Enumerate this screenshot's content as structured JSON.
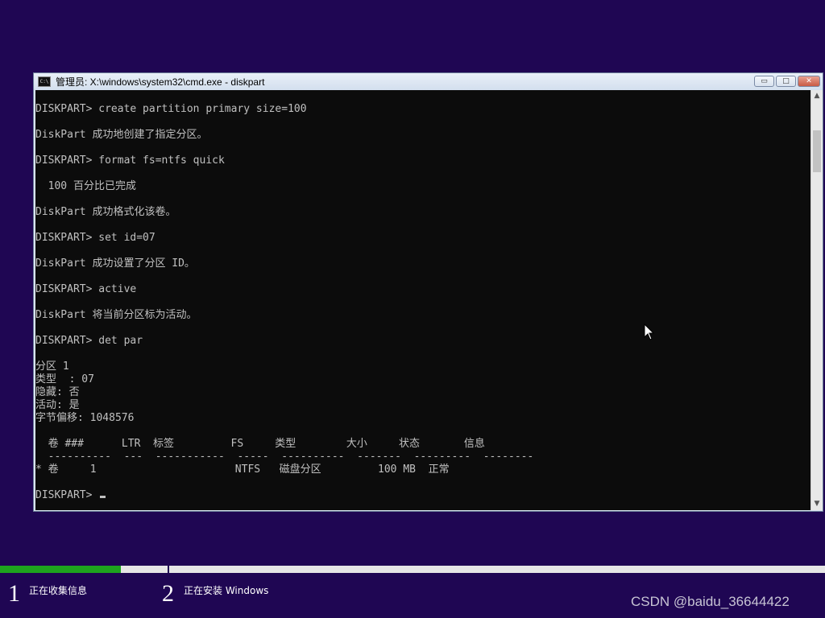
{
  "window": {
    "title": "管理员: X:\\windows\\system32\\cmd.exe - diskpart",
    "icon_label": "C:\\",
    "buttons": {
      "minimize": "▭",
      "maximize": "□",
      "close": "✕"
    }
  },
  "console": {
    "lines": [
      "DISKPART> create partition primary size=100",
      "DiskPart 成功地创建了指定分区。",
      "DISKPART> format fs=ntfs quick",
      "  100 百分比已完成",
      "DiskPart 成功格式化该卷。",
      "DISKPART> set id=07",
      "DiskPart 成功设置了分区 ID。",
      "DISKPART> active",
      "DiskPart 将当前分区标为活动。",
      "DISKPART> det par",
      "分区 1",
      "类型  : 07",
      "隐藏: 否",
      "活动: 是",
      "字节偏移: 1048576",
      "  卷 ###      LTR  标签         FS     类型        大小     状态       信息",
      "  ----------  ---  -----------  -----  ----------  -------  ---------  --------",
      "* 卷     1                      NTFS   磁盘分区         100 MB  正常",
      "DISKPART> "
    ]
  },
  "setup_progress": {
    "fill_percent": 14.6,
    "steps": [
      {
        "number": "1",
        "label": "正在收集信息"
      },
      {
        "number": "2",
        "label": "正在安装 Windows"
      }
    ]
  },
  "watermark": "CSDN @baidu_36644422",
  "colors": {
    "desktop": "#1f0653",
    "console_bg": "#0c0c0c",
    "console_text": "#c0c0c0",
    "progress": "#1ea41e"
  }
}
